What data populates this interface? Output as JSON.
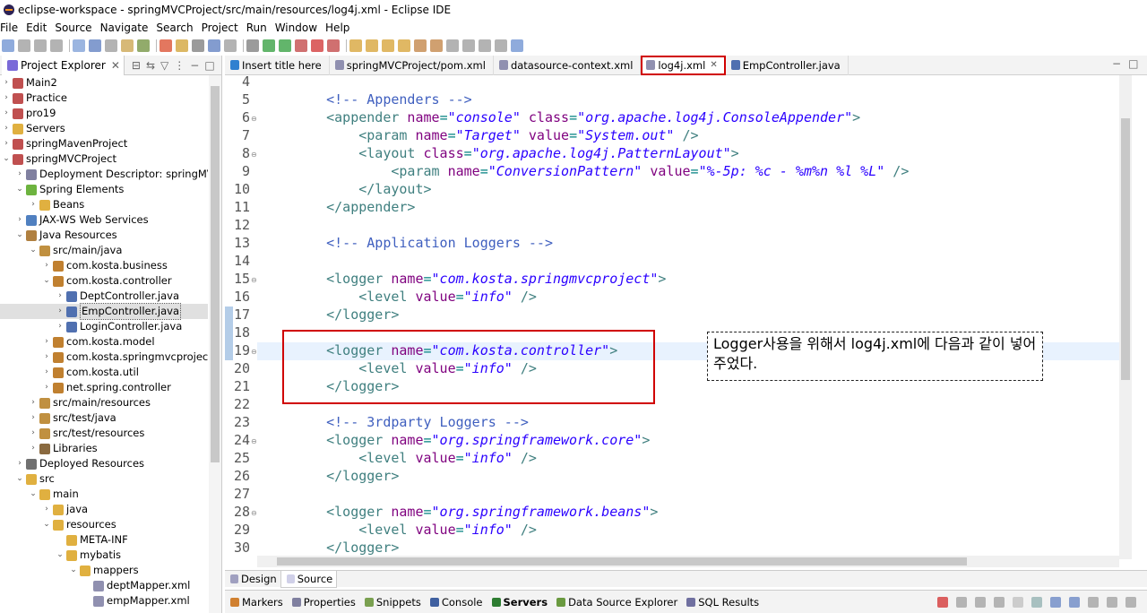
{
  "window": {
    "title": "eclipse-workspace - springMVCProject/src/main/resources/log4j.xml - Eclipse IDE"
  },
  "menu": [
    "File",
    "Edit",
    "Source",
    "Navigate",
    "Search",
    "Project",
    "Run",
    "Window",
    "Help"
  ],
  "project_explorer": {
    "tab_label": "Project Explorer",
    "tree": [
      {
        "label": "Main2",
        "level": 0,
        "twisty": "›",
        "icon": "project-icon"
      },
      {
        "label": "Practice",
        "level": 0,
        "twisty": "›",
        "icon": "project-icon"
      },
      {
        "label": "pro19",
        "level": 0,
        "twisty": "›",
        "icon": "project-icon"
      },
      {
        "label": "Servers",
        "level": 0,
        "twisty": "›",
        "icon": "folder-icon"
      },
      {
        "label": "springMavenProject",
        "level": 0,
        "twisty": "›",
        "icon": "project-icon"
      },
      {
        "label": "springMVCProject",
        "level": 0,
        "twisty": "⌄",
        "icon": "project-icon"
      },
      {
        "label": "Deployment Descriptor: springMVCPr",
        "level": 1,
        "twisty": "›",
        "icon": "descriptor-icon"
      },
      {
        "label": "Spring Elements",
        "level": 1,
        "twisty": "⌄",
        "icon": "spring-icon"
      },
      {
        "label": "Beans",
        "level": 2,
        "twisty": "›",
        "icon": "folder-icon"
      },
      {
        "label": "JAX-WS Web Services",
        "level": 1,
        "twisty": "›",
        "icon": "webservice-icon"
      },
      {
        "label": "Java Resources",
        "level": 1,
        "twisty": "⌄",
        "icon": "java-resources-icon"
      },
      {
        "label": "src/main/java",
        "level": 2,
        "twisty": "⌄",
        "icon": "source-folder-icon"
      },
      {
        "label": "com.kosta.business",
        "level": 3,
        "twisty": "›",
        "icon": "package-icon"
      },
      {
        "label": "com.kosta.controller",
        "level": 3,
        "twisty": "⌄",
        "icon": "package-icon"
      },
      {
        "label": "DeptController.java",
        "level": 4,
        "twisty": "›",
        "icon": "java-file-icon"
      },
      {
        "label": "EmpController.java",
        "level": 4,
        "twisty": "›",
        "icon": "java-file-icon",
        "selected": true
      },
      {
        "label": "LoginController.java",
        "level": 4,
        "twisty": "›",
        "icon": "java-file-icon"
      },
      {
        "label": "com.kosta.model",
        "level": 3,
        "twisty": "›",
        "icon": "package-icon"
      },
      {
        "label": "com.kosta.springmvcproject",
        "level": 3,
        "twisty": "›",
        "icon": "package-icon"
      },
      {
        "label": "com.kosta.util",
        "level": 3,
        "twisty": "›",
        "icon": "package-icon"
      },
      {
        "label": "net.spring.controller",
        "level": 3,
        "twisty": "›",
        "icon": "package-icon"
      },
      {
        "label": "src/main/resources",
        "level": 2,
        "twisty": "›",
        "icon": "source-folder-icon"
      },
      {
        "label": "src/test/java",
        "level": 2,
        "twisty": "›",
        "icon": "source-folder-icon"
      },
      {
        "label": "src/test/resources",
        "level": 2,
        "twisty": "›",
        "icon": "source-folder-icon"
      },
      {
        "label": "Libraries",
        "level": 2,
        "twisty": "›",
        "icon": "library-icon"
      },
      {
        "label": "Deployed Resources",
        "level": 1,
        "twisty": "›",
        "icon": "deployed-icon"
      },
      {
        "label": "src",
        "level": 1,
        "twisty": "⌄",
        "icon": "folder-icon"
      },
      {
        "label": "main",
        "level": 2,
        "twisty": "⌄",
        "icon": "folder-icon"
      },
      {
        "label": "java",
        "level": 3,
        "twisty": "›",
        "icon": "folder-icon"
      },
      {
        "label": "resources",
        "level": 3,
        "twisty": "⌄",
        "icon": "folder-icon"
      },
      {
        "label": "META-INF",
        "level": 4,
        "twisty": "",
        "icon": "folder-icon"
      },
      {
        "label": "mybatis",
        "level": 4,
        "twisty": "⌄",
        "icon": "folder-icon"
      },
      {
        "label": "mappers",
        "level": 5,
        "twisty": "⌄",
        "icon": "folder-icon"
      },
      {
        "label": "deptMapper.xml",
        "level": 6,
        "twisty": "",
        "icon": "xml-file-icon"
      },
      {
        "label": "empMapper.xml",
        "level": 6,
        "twisty": "",
        "icon": "xml-file-icon"
      }
    ]
  },
  "editor": {
    "tabs": [
      {
        "label": "Insert title here",
        "icon": "browser-icon",
        "active": false
      },
      {
        "label": "springMVCProject/pom.xml",
        "icon": "xml-file-icon",
        "active": false
      },
      {
        "label": "datasource-context.xml",
        "icon": "xml-file-icon",
        "active": false
      },
      {
        "label": "log4j.xml",
        "icon": "xml-file-icon",
        "active": true,
        "close": "✕"
      },
      {
        "label": "EmpController.java",
        "icon": "java-file-icon",
        "active": false
      }
    ],
    "lines": [
      {
        "n": "4",
        "fold": false,
        "tokens": []
      },
      {
        "n": "5",
        "fold": false,
        "tokens": [
          {
            "t": "    ",
            "c": ""
          },
          {
            "t": "<!-- Appenders -->",
            "c": "c-com"
          }
        ]
      },
      {
        "n": "6",
        "fold": true,
        "tokens": [
          {
            "t": "    <",
            "c": "c-tag"
          },
          {
            "t": "appender",
            "c": "c-tag"
          },
          {
            "t": " name",
            "c": "c-attr"
          },
          {
            "t": "=",
            "c": ""
          },
          {
            "t": "\"console\"",
            "c": "c-val"
          },
          {
            "t": " class",
            "c": "c-attr"
          },
          {
            "t": "=",
            "c": ""
          },
          {
            "t": "\"org.apache.log4j.ConsoleAppender\"",
            "c": "c-val"
          },
          {
            "t": ">",
            "c": "c-tag"
          }
        ]
      },
      {
        "n": "7",
        "fold": false,
        "tokens": [
          {
            "t": "        <param",
            "c": "c-tag"
          },
          {
            "t": " name",
            "c": "c-attr"
          },
          {
            "t": "=",
            "c": ""
          },
          {
            "t": "\"Target\"",
            "c": "c-val"
          },
          {
            "t": " value",
            "c": "c-attr"
          },
          {
            "t": "=",
            "c": ""
          },
          {
            "t": "\"System.out\"",
            "c": "c-val"
          },
          {
            "t": " />",
            "c": "c-tag"
          }
        ]
      },
      {
        "n": "8",
        "fold": true,
        "tokens": [
          {
            "t": "        <layout",
            "c": "c-tag"
          },
          {
            "t": " class",
            "c": "c-attr"
          },
          {
            "t": "=",
            "c": ""
          },
          {
            "t": "\"org.apache.log4j.PatternLayout\"",
            "c": "c-val"
          },
          {
            "t": ">",
            "c": "c-tag"
          }
        ]
      },
      {
        "n": "9",
        "fold": false,
        "tokens": [
          {
            "t": "            <param",
            "c": "c-tag"
          },
          {
            "t": " name",
            "c": "c-attr"
          },
          {
            "t": "=",
            "c": ""
          },
          {
            "t": "\"ConversionPattern\"",
            "c": "c-val"
          },
          {
            "t": " value",
            "c": "c-attr"
          },
          {
            "t": "=",
            "c": ""
          },
          {
            "t": "\"%-5p: %c - %m%n %l %L\"",
            "c": "c-val"
          },
          {
            "t": " />",
            "c": "c-tag"
          }
        ]
      },
      {
        "n": "10",
        "fold": false,
        "tokens": [
          {
            "t": "        </layout>",
            "c": "c-tag"
          }
        ]
      },
      {
        "n": "11",
        "fold": false,
        "tokens": [
          {
            "t": "    </appender>",
            "c": "c-tag"
          }
        ]
      },
      {
        "n": "12",
        "fold": false,
        "tokens": []
      },
      {
        "n": "13",
        "fold": false,
        "tokens": [
          {
            "t": "    ",
            "c": ""
          },
          {
            "t": "<!-- Application Loggers -->",
            "c": "c-com"
          }
        ]
      },
      {
        "n": "14",
        "fold": false,
        "tokens": []
      },
      {
        "n": "15",
        "fold": true,
        "tokens": [
          {
            "t": "    <logger",
            "c": "c-tag"
          },
          {
            "t": " name",
            "c": "c-attr"
          },
          {
            "t": "=",
            "c": ""
          },
          {
            "t": "\"com.kosta.springmvcproject\"",
            "c": "c-val"
          },
          {
            "t": ">",
            "c": "c-tag"
          }
        ]
      },
      {
        "n": "16",
        "fold": false,
        "tokens": [
          {
            "t": "        <level",
            "c": "c-tag"
          },
          {
            "t": " value",
            "c": "c-attr"
          },
          {
            "t": "=",
            "c": ""
          },
          {
            "t": "\"info\"",
            "c": "c-val"
          },
          {
            "t": " />",
            "c": "c-tag"
          }
        ]
      },
      {
        "n": "17",
        "fold": false,
        "tokens": [
          {
            "t": "    </logger>",
            "c": "c-tag"
          }
        ]
      },
      {
        "n": "18",
        "fold": false,
        "tokens": []
      },
      {
        "n": "19",
        "fold": true,
        "tokens": [
          {
            "t": "    <logger",
            "c": "c-tag"
          },
          {
            "t": " name",
            "c": "c-attr"
          },
          {
            "t": "=",
            "c": ""
          },
          {
            "t": "\"com.kosta.controller\"",
            "c": "c-val"
          },
          {
            "t": ">",
            "c": "c-tag"
          }
        ]
      },
      {
        "n": "20",
        "fold": false,
        "tokens": [
          {
            "t": "        <level",
            "c": "c-tag"
          },
          {
            "t": " value",
            "c": "c-attr"
          },
          {
            "t": "=",
            "c": ""
          },
          {
            "t": "\"info\"",
            "c": "c-val"
          },
          {
            "t": " />",
            "c": "c-tag"
          }
        ]
      },
      {
        "n": "21",
        "fold": false,
        "tokens": [
          {
            "t": "    </logger>",
            "c": "c-tag"
          }
        ]
      },
      {
        "n": "22",
        "fold": false,
        "tokens": []
      },
      {
        "n": "23",
        "fold": false,
        "tokens": [
          {
            "t": "    ",
            "c": ""
          },
          {
            "t": "<!-- 3rdparty Loggers -->",
            "c": "c-com"
          }
        ]
      },
      {
        "n": "24",
        "fold": true,
        "tokens": [
          {
            "t": "    <logger",
            "c": "c-tag"
          },
          {
            "t": " name",
            "c": "c-attr"
          },
          {
            "t": "=",
            "c": ""
          },
          {
            "t": "\"org.springframework.core\"",
            "c": "c-val"
          },
          {
            "t": ">",
            "c": "c-tag"
          }
        ]
      },
      {
        "n": "25",
        "fold": false,
        "tokens": [
          {
            "t": "        <level",
            "c": "c-tag"
          },
          {
            "t": " value",
            "c": "c-attr"
          },
          {
            "t": "=",
            "c": ""
          },
          {
            "t": "\"info\"",
            "c": "c-val"
          },
          {
            "t": " />",
            "c": "c-tag"
          }
        ]
      },
      {
        "n": "26",
        "fold": false,
        "tokens": [
          {
            "t": "    </logger>",
            "c": "c-tag"
          }
        ]
      },
      {
        "n": "27",
        "fold": false,
        "tokens": []
      },
      {
        "n": "28",
        "fold": true,
        "tokens": [
          {
            "t": "    <logger",
            "c": "c-tag"
          },
          {
            "t": " name",
            "c": "c-attr"
          },
          {
            "t": "=",
            "c": ""
          },
          {
            "t": "\"org.springframework.beans\"",
            "c": "c-val"
          },
          {
            "t": ">",
            "c": "c-tag"
          }
        ]
      },
      {
        "n": "29",
        "fold": false,
        "tokens": [
          {
            "t": "        <level",
            "c": "c-tag"
          },
          {
            "t": " value",
            "c": "c-attr"
          },
          {
            "t": "=",
            "c": ""
          },
          {
            "t": "\"info\"",
            "c": "c-val"
          },
          {
            "t": " />",
            "c": "c-tag"
          }
        ]
      },
      {
        "n": "30",
        "fold": false,
        "tokens": [
          {
            "t": "    </logger>",
            "c": "c-tag"
          }
        ]
      }
    ],
    "highlighted_line": "19",
    "bottom_tabs": [
      {
        "label": "Design",
        "active": false
      },
      {
        "label": "Source",
        "active": true
      }
    ]
  },
  "annotation": {
    "text": "Logger사용을 위해서 log4j.xml에 다음과 같이 넣어주었다."
  },
  "bottom_panel": {
    "tabs": [
      "Markers",
      "Properties",
      "Snippets",
      "Console",
      "Servers",
      "Data Source Explorer",
      "SQL Results"
    ],
    "active": "Servers"
  },
  "colors": {
    "highlight_box": "#d00000",
    "comment": "#3f5fbf",
    "tag": "#3f7f7f",
    "attr": "#7f007f",
    "value": "#2a00ff"
  }
}
